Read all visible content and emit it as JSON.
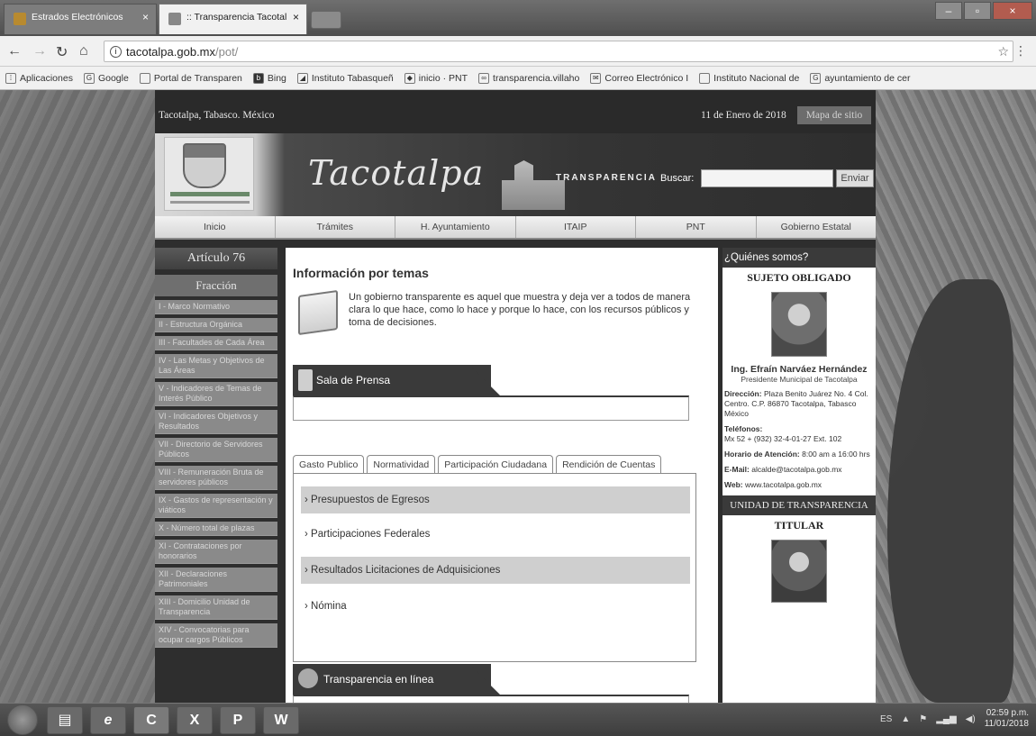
{
  "browser": {
    "tabs": [
      {
        "label": "Estrados Electrónicos"
      },
      {
        "label": ":: Transparencia Tacotal"
      }
    ],
    "url": {
      "host": "tacotalpa.gob.mx",
      "path": "/pot/"
    },
    "bookmarks": [
      {
        "label": "Aplicaciones",
        "icon": "apps-icon"
      },
      {
        "label": "Google",
        "icon": "google-icon"
      },
      {
        "label": "Portal de Transparen",
        "icon": "page-icon"
      },
      {
        "label": "Bing",
        "icon": "bing-icon"
      },
      {
        "label": "Instituto Tabasqueñ",
        "icon": "itaip-icon"
      },
      {
        "label": "inicio · PNT",
        "icon": "pnt-icon"
      },
      {
        "label": "transparencia.villaho",
        "icon": "link-icon"
      },
      {
        "label": "Correo Electrónico I",
        "icon": "mail-icon"
      },
      {
        "label": "Instituto Nacional de",
        "icon": "page-icon"
      },
      {
        "label": "ayuntamiento de cer",
        "icon": "google-icon"
      }
    ]
  },
  "site": {
    "location": "Tacotalpa, Tabasco. México",
    "date": "11 de Enero de 2018",
    "sitemap": "Mapa de sitio",
    "brand": "Tacotalpa",
    "transparency_word": "TRANSPARENCIA",
    "search_label": "Buscar:",
    "search_button": "Enviar",
    "nav": [
      "Inicio",
      "Trámites",
      "H. Ayuntamiento",
      "ITAIP",
      "PNT",
      "Gobierno Estatal"
    ]
  },
  "sidebar": {
    "article": "Artículo 76",
    "fraction": "Fracción",
    "items": [
      "I - Marco Normativo",
      "II - Estructura Orgánica",
      "III - Facultades de Cada Área",
      "IV - Las Metas y Objetivos de Las Áreas",
      "V - Indicadores de Temas de Interés Público",
      "VI - Indicadores Objetivos y Resultados",
      "VII - Directorio de Servidores Públicos",
      "VIII - Remuneración Bruta de servidores públicos",
      "IX - Gastos de representación y viáticos",
      "X - Número total de plazas",
      "XI - Contrataciones por honorarios",
      "XII - Declaraciones Patrimoniales",
      "XIII - Domicilio Unidad de Transparencia",
      "XIV - Convocatorias para ocupar cargos Públicos"
    ]
  },
  "main": {
    "heading": "Información por temas",
    "intro": "Un gobierno transparente es aquel que muestra y deja ver a todos de manera clara lo que hace, como lo hace y porque lo hace, con los recursos públicos y toma de decisiones.",
    "press_title": "Sala de Prensa",
    "tabs": [
      "Gasto Publico",
      "Normatividad",
      "Participación Ciudadana",
      "Rendición de Cuentas"
    ],
    "rows": [
      "Presupuestos de Egresos",
      "Participaciones Federales",
      "Resultados Licitaciones de Adquisiciones",
      "Nómina"
    ],
    "online_title": "Transparencia en línea"
  },
  "right": {
    "header": "¿Quiénes somos?",
    "subject_title": "SUJETO OBLIGADO",
    "name": "Ing. Efraín Narváez Hernández",
    "position": "Presidente Municipal de Tacotalpa",
    "address_label": "Dirección:",
    "address": "Plaza Benito Juárez No. 4 Col. Centro. C.P. 86870 Tacotalpa, Tabasco México",
    "phones_label": "Teléfonos:",
    "phones": "Mx 52 + (932) 32-4-01-27 Ext. 102",
    "hours_label": "Horario de Atención:",
    "hours": "8:00 am a 16:00 hrs",
    "email_label": "E-Mail:",
    "email": "alcalde@tacotalpa.gob.mx",
    "web_label": "Web:",
    "web": "www.tacotalpa.gob.mx",
    "unit_header": "UNIDAD DE TRANSPARENCIA",
    "titular": "TITULAR"
  },
  "taskbar": {
    "apps": [
      {
        "icon": "explorer-icon"
      },
      {
        "icon": "ie-icon",
        "glyph": "e"
      },
      {
        "icon": "chrome-icon",
        "glyph": "C"
      },
      {
        "icon": "excel-icon",
        "glyph": "X"
      },
      {
        "icon": "powerpoint-icon",
        "glyph": "P"
      },
      {
        "icon": "word-icon",
        "glyph": "W"
      }
    ],
    "lang": "ES",
    "time": "02:59 p.m.",
    "date": "11/01/2018"
  }
}
